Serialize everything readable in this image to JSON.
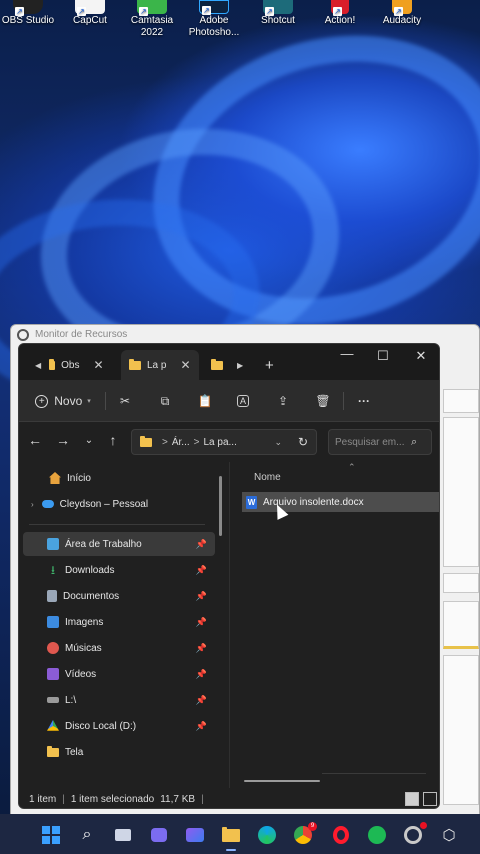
{
  "desktop": {
    "icons": [
      {
        "label": "OBS Studio",
        "icon": "obs-icon"
      },
      {
        "label": "CapCut",
        "icon": "capcut-icon"
      },
      {
        "label": "Camtasia 2022",
        "icon": "camtasia-icon"
      },
      {
        "label": "Adobe Photosho...",
        "icon": "photoshop-icon"
      },
      {
        "label": "Shotcut",
        "icon": "shotcut-icon"
      },
      {
        "label": "Action!",
        "icon": "action-icon"
      },
      {
        "label": "Audacity",
        "icon": "audacity-icon"
      }
    ]
  },
  "background_window": {
    "title": "Monitor de Recursos"
  },
  "explorer": {
    "tabs": [
      {
        "label": "Obs",
        "close": "✕"
      },
      {
        "label": "La p",
        "close": "✕"
      },
      {
        "label": "",
        "close": ""
      }
    ],
    "new_tab": "+",
    "window_controls": {
      "minimize": "—",
      "maximize": "☐",
      "close": "✕"
    },
    "toolbar": {
      "new_label": "Novo",
      "more": "···"
    },
    "address": {
      "segment1": "Ár...",
      "segment2": "La pa...",
      "separator": ">"
    },
    "search": {
      "placeholder": "Pesquisar em..."
    },
    "nav": {
      "home": "Início",
      "onedrive": "Cleydson – Pessoal",
      "quick_access": [
        {
          "label": "Área de Trabalho",
          "color": "#4aa3df"
        },
        {
          "label": "Downloads",
          "color": "#3fb36b"
        },
        {
          "label": "Documentos",
          "color": "#9aa7b8"
        },
        {
          "label": "Imagens",
          "color": "#3c8be0"
        },
        {
          "label": "Músicas",
          "color": "#e0584f"
        },
        {
          "label": "Vídeos",
          "color": "#8b5cd6"
        },
        {
          "label": "L:\\",
          "color": "#9a9a9a"
        },
        {
          "label": "Disco Local (D:)",
          "color": "#34a853"
        },
        {
          "label": "Tela",
          "color": "#f2c14e"
        }
      ]
    },
    "content": {
      "column_name": "Nome",
      "files": [
        {
          "name": "Arquivo insolente.docx",
          "type_glyph": "W"
        }
      ]
    },
    "status": {
      "items": "1 item",
      "selected": "1 item selecionado",
      "size": "11,7 KB"
    }
  },
  "taskbar": {
    "icons": [
      "start-icon",
      "search-icon",
      "task-view-icon",
      "chat-icon",
      "widgets-icon",
      "file-explorer-icon",
      "edge-icon",
      "chrome-icon",
      "opera-icon",
      "spotify-icon",
      "davinci-icon",
      "box-icon"
    ],
    "chrome_badge": "9"
  },
  "colors": {
    "explorer_bg": "#202020",
    "toolbar_bg": "#2c2c2c",
    "selection": "#4d4d4d",
    "folder": "#f2c14e",
    "taskbar": "#1d2742"
  }
}
